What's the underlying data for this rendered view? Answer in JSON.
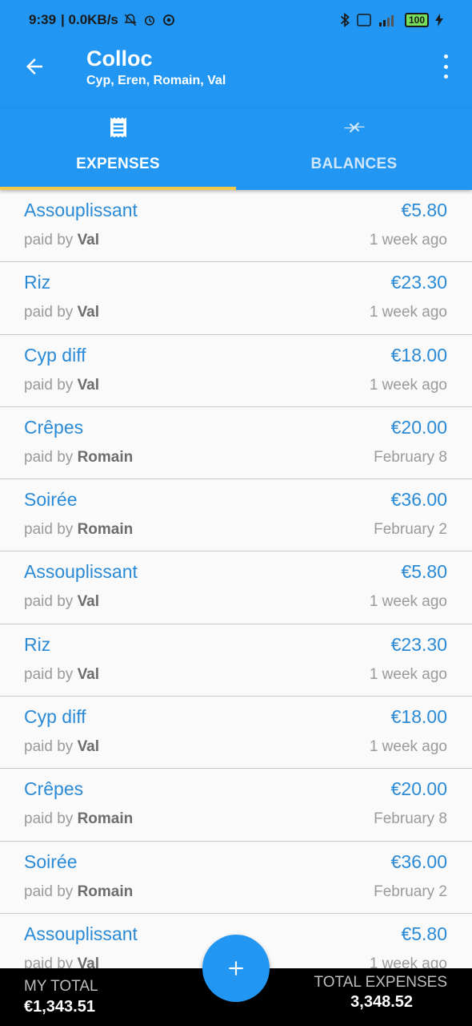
{
  "status_bar": {
    "time": "9:39",
    "network_speed": "| 0.0KB/s",
    "battery": "100"
  },
  "app_bar": {
    "title": "Colloc",
    "subtitle": "Cyp, Eren, Romain, Val"
  },
  "tabs": [
    {
      "label": "EXPENSES",
      "icon": "receipt-icon",
      "selected": true
    },
    {
      "label": "BALANCES",
      "icon": "transfer-arrows-icon",
      "selected": false
    }
  ],
  "expenses": [
    {
      "name": "Assouplissant",
      "amount": "€5.80",
      "paid_prefix": "paid by",
      "payer": "Val",
      "when": "1 week ago"
    },
    {
      "name": "Riz",
      "amount": "€23.30",
      "paid_prefix": "paid by",
      "payer": "Val",
      "when": "1 week ago"
    },
    {
      "name": "Cyp diff",
      "amount": "€18.00",
      "paid_prefix": "paid by",
      "payer": "Val",
      "when": "1 week ago"
    },
    {
      "name": "Crêpes",
      "amount": "€20.00",
      "paid_prefix": "paid by",
      "payer": "Romain",
      "when": "February 8"
    },
    {
      "name": "Soirée",
      "amount": "€36.00",
      "paid_prefix": "paid by",
      "payer": "Romain",
      "when": "February 2"
    },
    {
      "name": "Assouplissant",
      "amount": "€5.80",
      "paid_prefix": "paid by",
      "payer": "Val",
      "when": "1 week ago"
    },
    {
      "name": "Riz",
      "amount": "€23.30",
      "paid_prefix": "paid by",
      "payer": "Val",
      "when": "1 week ago"
    },
    {
      "name": "Cyp diff",
      "amount": "€18.00",
      "paid_prefix": "paid by",
      "payer": "Val",
      "when": "1 week ago"
    },
    {
      "name": "Crêpes",
      "amount": "€20.00",
      "paid_prefix": "paid by",
      "payer": "Romain",
      "when": "February 8"
    },
    {
      "name": "Soirée",
      "amount": "€36.00",
      "paid_prefix": "paid by",
      "payer": "Romain",
      "when": "February 2"
    },
    {
      "name": "Assouplissant",
      "amount": "€5.80",
      "paid_prefix": "paid by",
      "payer": "Val",
      "when": "1 week ago"
    }
  ],
  "footer": {
    "my_total_label": "MY TOTAL",
    "my_total_value": "€1,343.51",
    "total_expenses_label": "TOTAL EXPENSES",
    "total_expenses_value": "3,348.52"
  },
  "fab_icon": "plus-icon",
  "colors": {
    "primary": "#2196f3",
    "accent_indicator": "#f2c94c",
    "item_text": "#2a8ad6"
  }
}
